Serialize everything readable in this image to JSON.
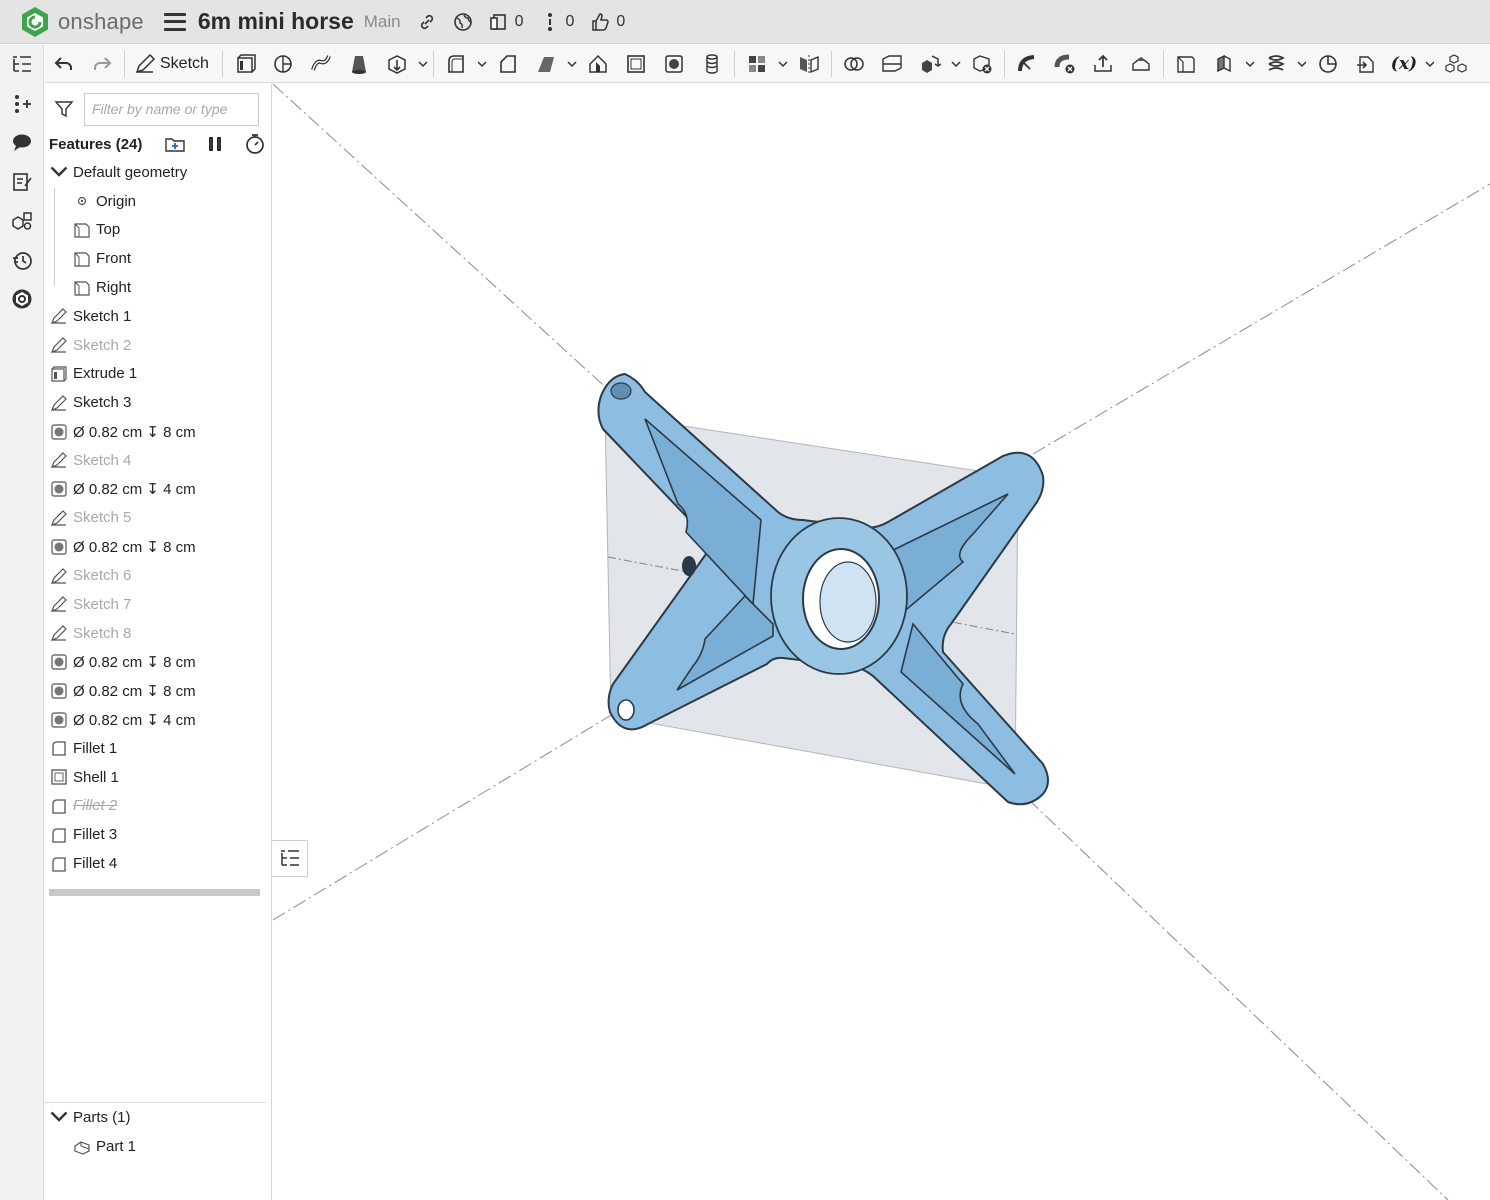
{
  "app": {
    "brand": "onshape",
    "document_title": "6m mini horse",
    "branch": "Main",
    "counts": {
      "versions": "0",
      "branches_info": "0",
      "likes": "0"
    }
  },
  "colors": {
    "brand_green": "#3fa54a",
    "part_blue": "#8dbde0",
    "part_edge": "#2b3a47",
    "plane_fill": "#dfe3e7"
  },
  "toolbar": {
    "sketch_label": "Sketch",
    "variables_label": "(x)"
  },
  "feature_panel": {
    "filter_placeholder": "Filter by name or type",
    "features_title": "Features (24)",
    "default_geometry": {
      "label": "Default geometry",
      "children": [
        "Origin",
        "Top",
        "Front",
        "Right"
      ]
    },
    "features": [
      {
        "label": "Sketch 1",
        "type": "sketch",
        "state": "normal"
      },
      {
        "label": "Sketch 2",
        "type": "sketch",
        "state": "hidden"
      },
      {
        "label": "Extrude 1",
        "type": "extrude",
        "state": "normal"
      },
      {
        "label": "Sketch 3",
        "type": "sketch",
        "state": "normal"
      },
      {
        "label": "Ø 0.82 cm ↧ 8 cm",
        "type": "hole",
        "state": "normal"
      },
      {
        "label": "Sketch 4",
        "type": "sketch",
        "state": "hidden"
      },
      {
        "label": "Ø 0.82 cm ↧ 4 cm",
        "type": "hole",
        "state": "normal"
      },
      {
        "label": "Sketch 5",
        "type": "sketch",
        "state": "hidden"
      },
      {
        "label": "Ø 0.82 cm ↧ 8 cm",
        "type": "hole",
        "state": "normal"
      },
      {
        "label": "Sketch 6",
        "type": "sketch",
        "state": "hidden"
      },
      {
        "label": "Sketch 7",
        "type": "sketch",
        "state": "hidden"
      },
      {
        "label": "Sketch 8",
        "type": "sketch",
        "state": "hidden"
      },
      {
        "label": "Ø 0.82 cm ↧ 8 cm",
        "type": "hole",
        "state": "normal"
      },
      {
        "label": "Ø 0.82 cm ↧ 8 cm",
        "type": "hole",
        "state": "normal"
      },
      {
        "label": "Ø 0.82 cm ↧ 4 cm",
        "type": "hole",
        "state": "normal"
      },
      {
        "label": "Fillet 1",
        "type": "fillet",
        "state": "normal"
      },
      {
        "label": "Shell 1",
        "type": "shell",
        "state": "normal"
      },
      {
        "label": "Fillet 2",
        "type": "fillet",
        "state": "suppressed"
      },
      {
        "label": "Fillet 3",
        "type": "fillet",
        "state": "normal"
      },
      {
        "label": "Fillet 4",
        "type": "fillet",
        "state": "normal"
      }
    ],
    "parts": {
      "label": "Parts (1)",
      "items": [
        "Part 1"
      ]
    }
  }
}
